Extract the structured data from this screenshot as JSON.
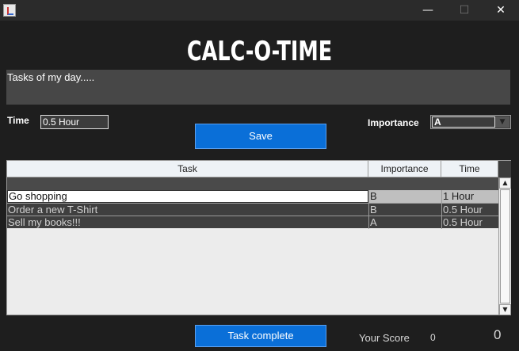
{
  "window": {
    "minimize_glyph": "—",
    "maximize_glyph": "☐",
    "close_glyph": "✕"
  },
  "app": {
    "title": "CALC-O-TIME"
  },
  "task_input": {
    "value": "Tasks of my day....."
  },
  "time": {
    "label": "Time",
    "value": "0.5 Hour"
  },
  "importance": {
    "label": "Importance",
    "selected": "A"
  },
  "save_button": {
    "label": "Save"
  },
  "table": {
    "columns": [
      "Task",
      "Importance",
      "Time"
    ],
    "rows": [
      {
        "task": "Go shopping",
        "importance": "B",
        "time": "1 Hour"
      },
      {
        "task": "Order a new T-Shirt",
        "importance": "B",
        "time": "0.5 Hour"
      },
      {
        "task": "Sell my books!!!",
        "importance": "A",
        "time": "0.5 Hour"
      }
    ]
  },
  "complete_button": {
    "label": "Task complete"
  },
  "score": {
    "label": "Your Score",
    "value_small": "0",
    "value_big": "0"
  },
  "colors": {
    "background": "#1e1e1e",
    "accent": "#0a6fd8"
  }
}
